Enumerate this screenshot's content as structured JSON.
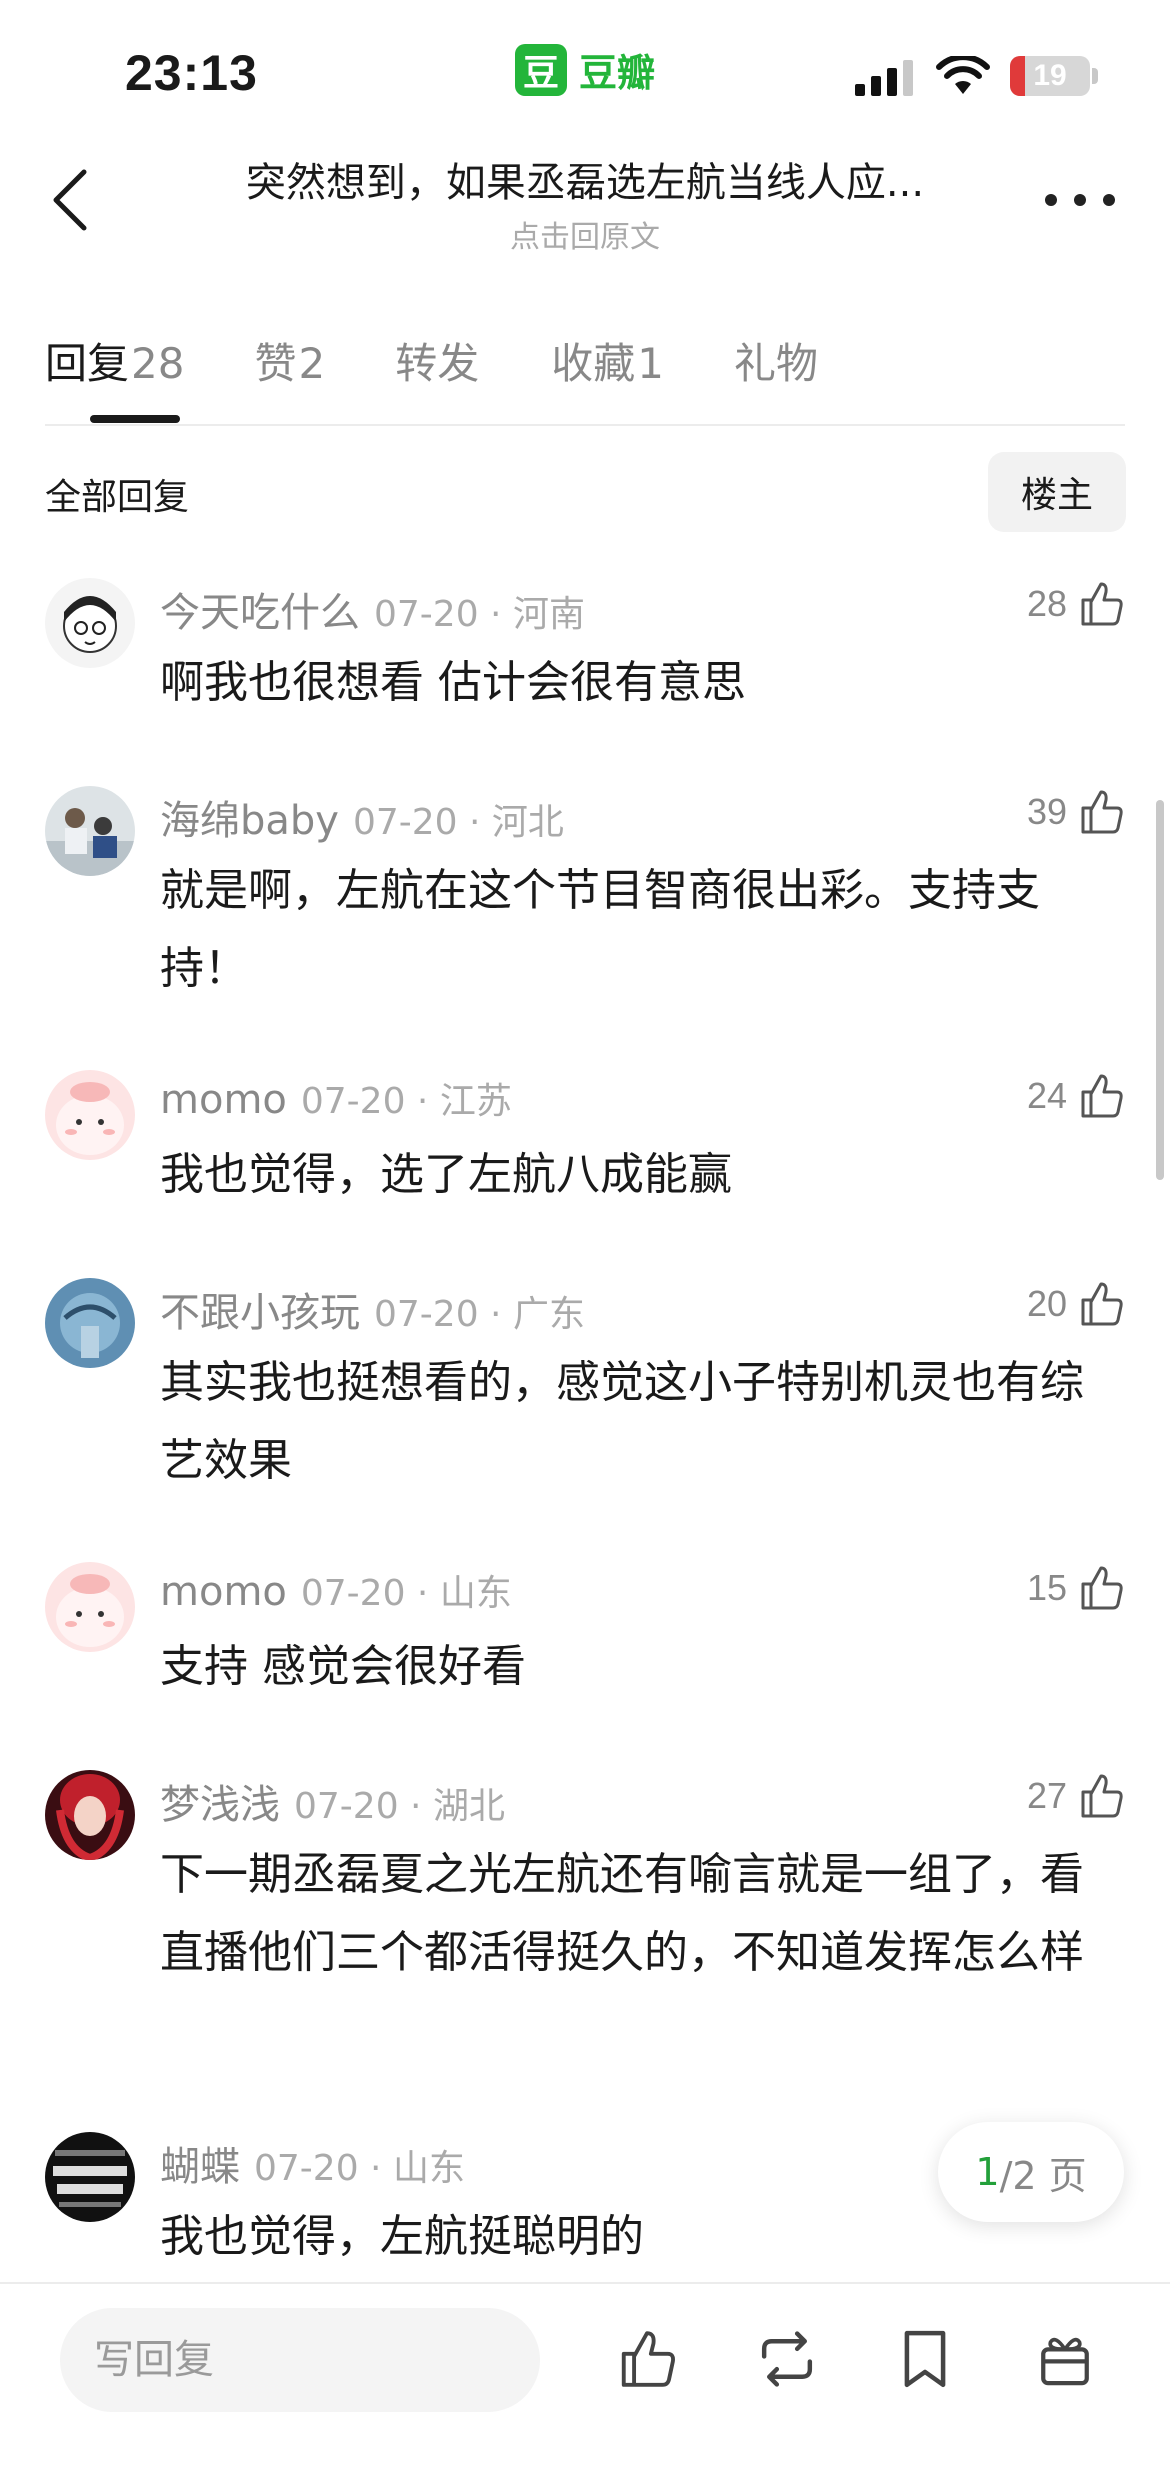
{
  "status_bar": {
    "time": "23:13",
    "app_logo_glyph": "豆",
    "app_name": "豆瓣",
    "battery_level": "19",
    "battery_fraction": 0.19,
    "accent_color": "#23b53a"
  },
  "header": {
    "title": "突然想到，如果丞磊选左航当线人应...",
    "subtitle": "点击回原文",
    "back_icon": "chevron-left-icon",
    "more_icon": "more-dots-icon"
  },
  "tabs": [
    {
      "label": "回复",
      "count": "28",
      "active": true
    },
    {
      "label": "赞",
      "count": "2",
      "active": false
    },
    {
      "label": "转发",
      "count": "",
      "active": false
    },
    {
      "label": "收藏",
      "count": "1",
      "active": false
    },
    {
      "label": "礼物",
      "count": "",
      "active": false
    }
  ],
  "filter": {
    "label": "全部回复",
    "button": "楼主"
  },
  "comments": [
    {
      "user": "今天吃什么",
      "date": "07-20 · 河南",
      "likes": "28",
      "text": "啊我也很想看 估计会很有意思"
    },
    {
      "user": "海绵baby",
      "date": "07-20 · 河北",
      "likes": "39",
      "text": "就是啊，左航在这个节目智商很出彩。支持支持！"
    },
    {
      "user": "momo",
      "date": "07-20 · 江苏",
      "likes": "24",
      "text": "我也觉得，选了左航八成能赢"
    },
    {
      "user": "不跟小孩玩",
      "date": "07-20 · 广东",
      "likes": "20",
      "text": "其实我也挺想看的，感觉这小子特别机灵也有综艺效果"
    },
    {
      "user": "momo",
      "date": "07-20 · 山东",
      "likes": "15",
      "text": "支持 感觉会很好看"
    },
    {
      "user": "梦浅浅",
      "date": "07-20 · 湖北",
      "likes": "27",
      "text": "下一期丞磊夏之光左航还有喻言就是一组了，看直播他们三个都活得挺久的，不知道发挥怎么样"
    },
    {
      "user": "蝴蝶",
      "date": "07-20 · 山东",
      "likes": "",
      "text": "我也觉得，左航挺聪明的"
    }
  ],
  "pager": {
    "current": "1",
    "total": "/2 页"
  },
  "bottom_bar": {
    "reply_placeholder": "写回复",
    "icons": [
      "thumbs-up-icon",
      "repost-icon",
      "bookmark-icon",
      "gift-icon"
    ]
  }
}
